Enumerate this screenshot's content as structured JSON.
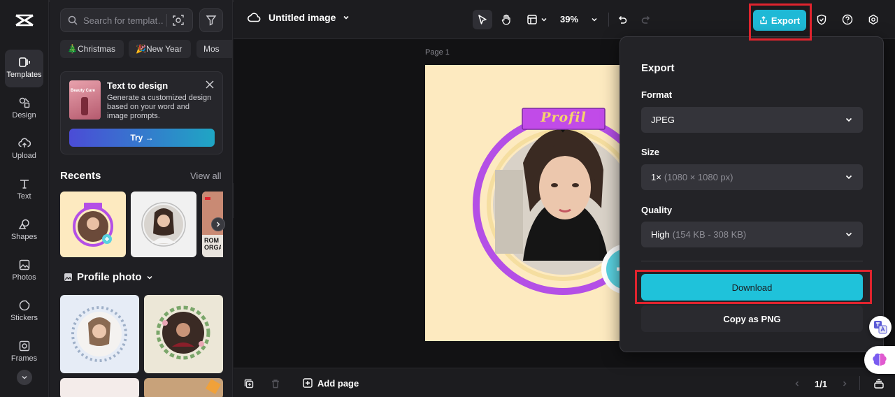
{
  "nav": {
    "items": [
      {
        "label": "Templates",
        "icon": "templates-icon"
      },
      {
        "label": "Design",
        "icon": "design-icon"
      },
      {
        "label": "Upload",
        "icon": "upload-icon"
      },
      {
        "label": "Text",
        "icon": "text-icon"
      },
      {
        "label": "Shapes",
        "icon": "shapes-icon"
      },
      {
        "label": "Photos",
        "icon": "photos-icon"
      },
      {
        "label": "Stickers",
        "icon": "stickers-icon"
      },
      {
        "label": "Frames",
        "icon": "frames-icon"
      }
    ],
    "active": "Templates"
  },
  "panel": {
    "search_placeholder": "Search for templat…",
    "chips": [
      "🎄Christmas",
      "🎉New Year",
      "Mos"
    ],
    "promo": {
      "thumb_text": "Beauty Care",
      "title": "Text to design",
      "description": "Generate a customized design based on your word and image prompts.",
      "button": "Try →"
    },
    "recents_title": "Recents",
    "view_all": "View all",
    "recent_tile_text": "ROM ORGA",
    "profile_title": "Profile photo"
  },
  "topbar": {
    "doc_title": "Untitled image",
    "zoom": "39%",
    "export_label": "Export"
  },
  "canvas": {
    "page_label": "Page 1",
    "banner_text": "Profil"
  },
  "export_panel": {
    "title": "Export",
    "format_label": "Format",
    "format_value": "JPEG",
    "size_label": "Size",
    "size_value": "1×",
    "size_detail": "(1080 × 1080 px)",
    "quality_label": "Quality",
    "quality_value": "High",
    "quality_detail": "(154 KB - 308 KB)",
    "download_label": "Download",
    "copy_label": "Copy as PNG"
  },
  "bottombar": {
    "add_page": "Add page",
    "page_count": "1/1"
  },
  "colors": {
    "accent": "#1fb9d6",
    "highlight": "#e0242e",
    "artboard_bg": "#fdeac0",
    "ring": "#b44fe6"
  }
}
